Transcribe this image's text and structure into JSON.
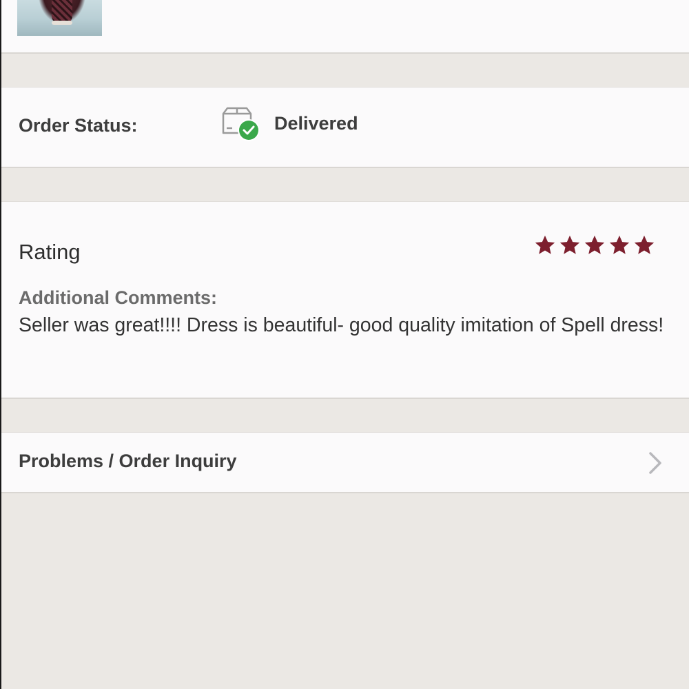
{
  "order_item": {
    "thumbnail_alt": "product-photo",
    "description": "... picture ... ... ... ... ... ... ... ... ..."
  },
  "order_status": {
    "label": "Order Status:",
    "value": "Delivered",
    "icon": "package-delivered-icon",
    "check_color": "#3aa84a"
  },
  "rating": {
    "label": "Rating",
    "stars": 5,
    "max_stars": 5,
    "star_color": "#7d1f2e",
    "comments_label": "Additional Comments:",
    "comments_text": "Seller was great!!!! Dress is beautiful- good quality imitation of Spell dress!"
  },
  "inquiry": {
    "label": "Problems / Order Inquiry",
    "icon": "chevron-right-icon"
  }
}
